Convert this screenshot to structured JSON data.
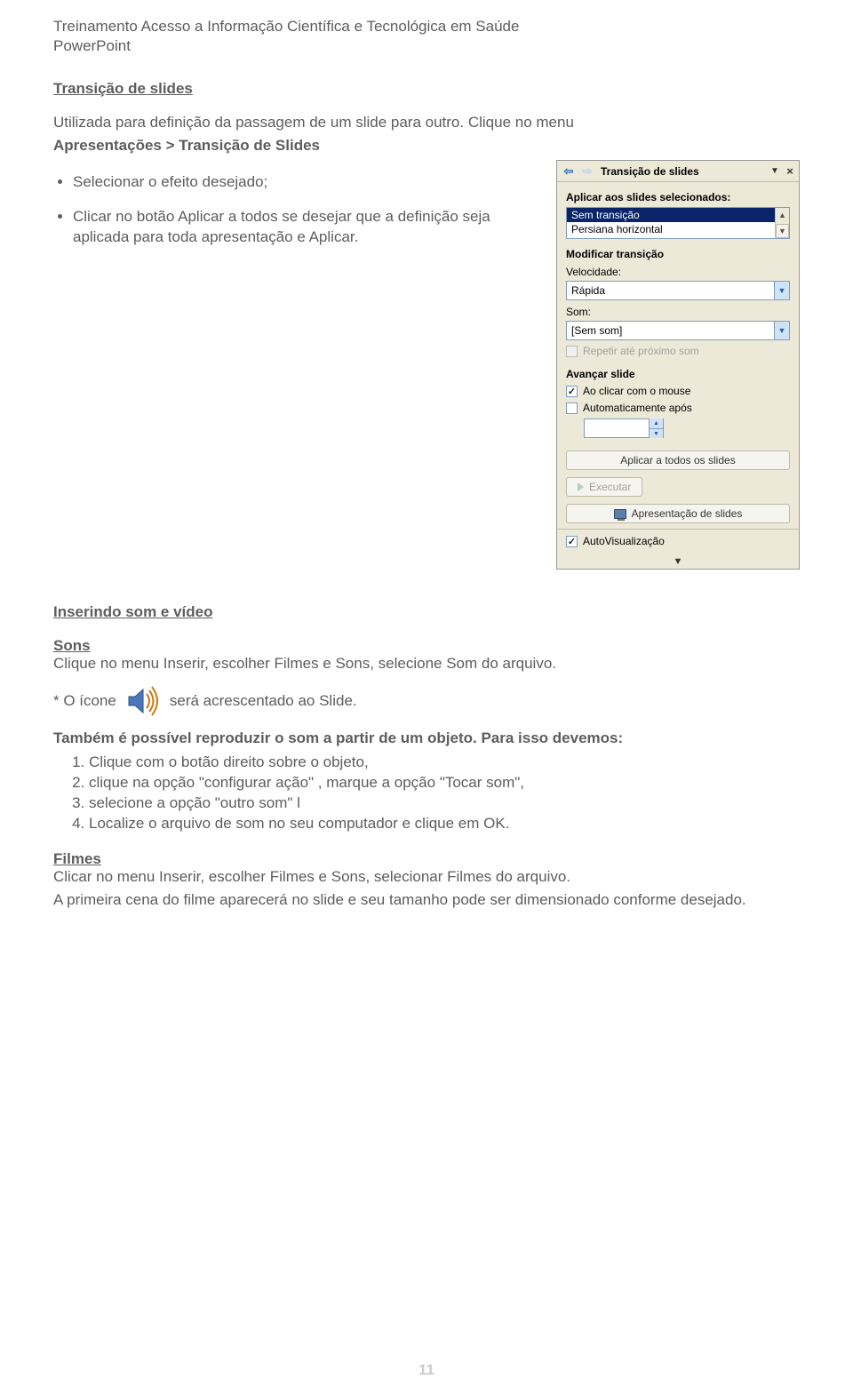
{
  "header": {
    "line1": "Treinamento Acesso a Informação Científica e Tecnológica em Saúde",
    "line2": "PowerPoint"
  },
  "section1": {
    "title": "Transição de slides",
    "intro1": "Utilizada para definição da passagem de um slide para outro. Clique no menu",
    "intro2": "Apresentações > Transição de Slides",
    "bullets": [
      "Selecionar o efeito desejado;",
      "Clicar no botão Aplicar a todos se desejar que a definição seja aplicada para toda apresentação e Aplicar."
    ]
  },
  "pane": {
    "title": "Transição de slides",
    "apply_label": "Aplicar aos slides selecionados:",
    "effects": {
      "selected": "Sem transição",
      "other": "Persiana horizontal"
    },
    "modify_label": "Modificar transição",
    "speed_label": "Velocidade:",
    "speed_value": "Rápida",
    "sound_label": "Som:",
    "sound_value": "[Sem som]",
    "repeat_label": "Repetir até próximo som",
    "advance_label": "Avançar slide",
    "on_click_label": "Ao clicar com o mouse",
    "auto_label": "Automaticamente após",
    "apply_all_btn": "Aplicar a todos os slides",
    "execute_btn": "Executar",
    "slideshow_btn": "Apresentação de slides",
    "auto_preview_label": "AutoVisualização"
  },
  "section2": {
    "title": "Inserindo som e vídeo",
    "sons_heading": "Sons",
    "sons_text": "Clique no menu Inserir, escolher Filmes e Sons, selecione Som do arquivo.",
    "icon_left": "* O ícone",
    "icon_right": "será acrescentado ao Slide.",
    "repro_intro": "Também é possível reproduzir o som a partir de um objeto. Para isso devemos:",
    "steps": [
      "Clique com o botão direito sobre o objeto,",
      "clique na opção \"configurar ação\" , marque a opção \"Tocar som\",",
      "selecione a opção \"outro som\" l",
      "Localize o arquivo de som no seu computador e clique em OK."
    ],
    "filmes_heading": "Filmes",
    "filmes_p1": "Clicar no menu Inserir, escolher Filmes e Sons, selecionar Filmes do arquivo.",
    "filmes_p2": "A primeira cena do filme aparecerá no slide e seu tamanho pode ser dimensionado conforme desejado."
  },
  "page_number": "11"
}
